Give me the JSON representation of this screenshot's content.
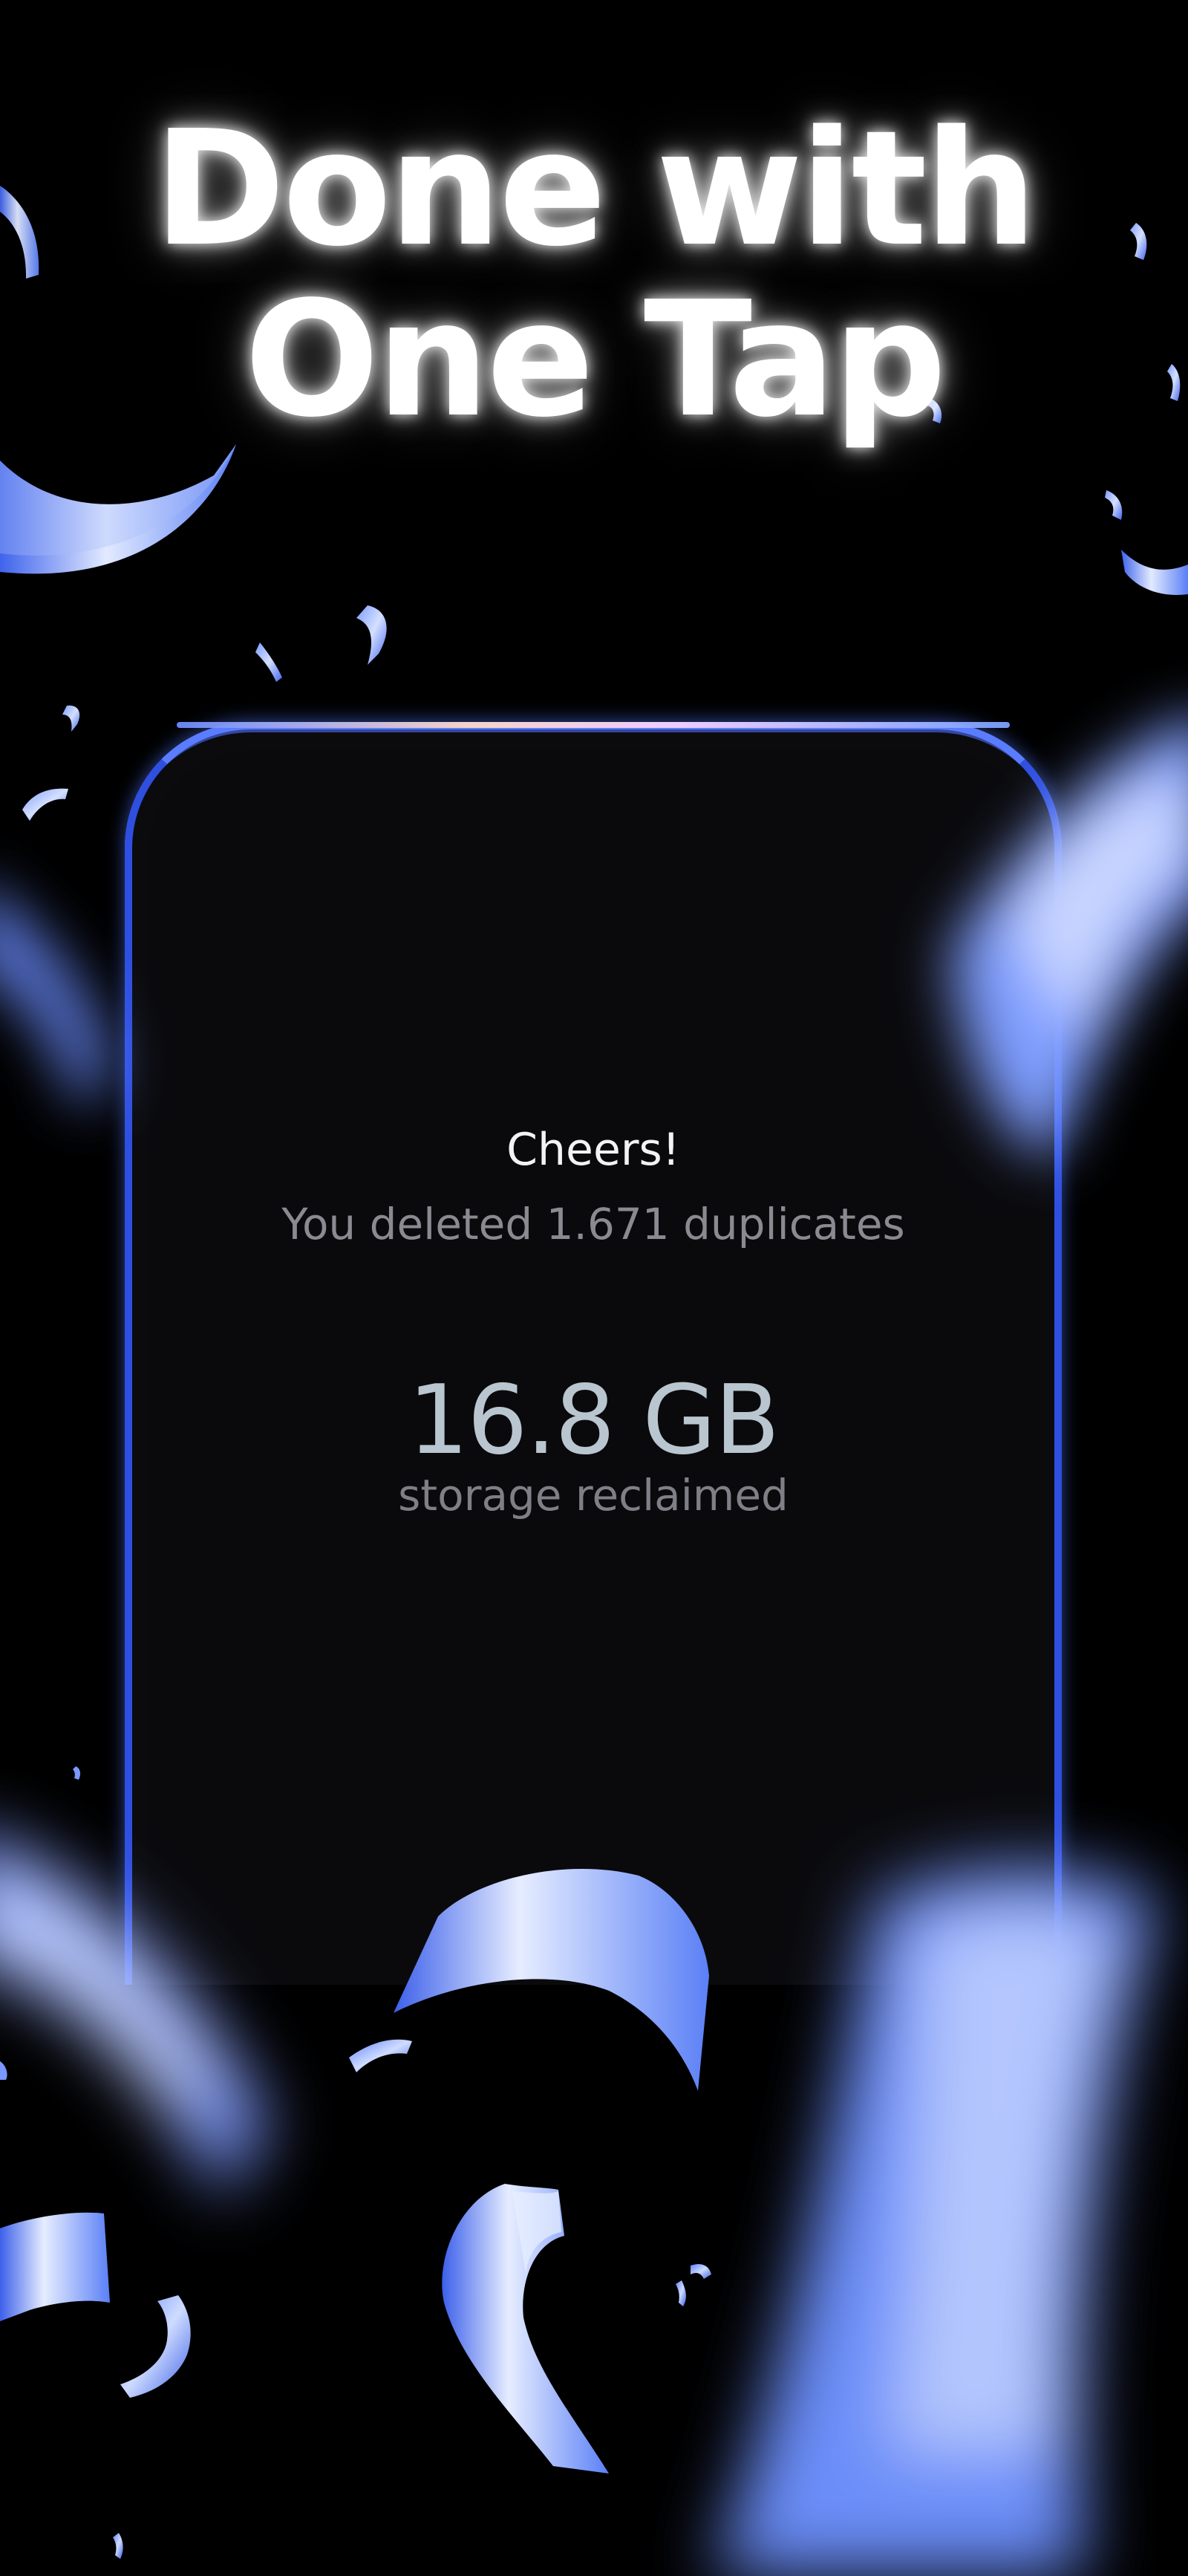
{
  "headline": {
    "line1": "Done with",
    "line2": "One Tap"
  },
  "screen": {
    "title": "Cheers!",
    "subtitle": "You deleted 1.671 duplicates",
    "storage_amount": "16.8 GB",
    "storage_label": "storage reclaimed"
  },
  "colors": {
    "background": "#000000",
    "accent_blue": "#6f93ff",
    "confetti_light": "#dbe5ff",
    "confetti_dark": "#3f5fe8",
    "screen": "#0a0a0d",
    "title_text": "#f3f3f5",
    "muted_text": "#8a8a90",
    "amount_text": "#b9c6cf"
  },
  "decorations": {
    "confetti_icon": "confetti-ribbon",
    "phone_icon": "smartphone-frame"
  }
}
